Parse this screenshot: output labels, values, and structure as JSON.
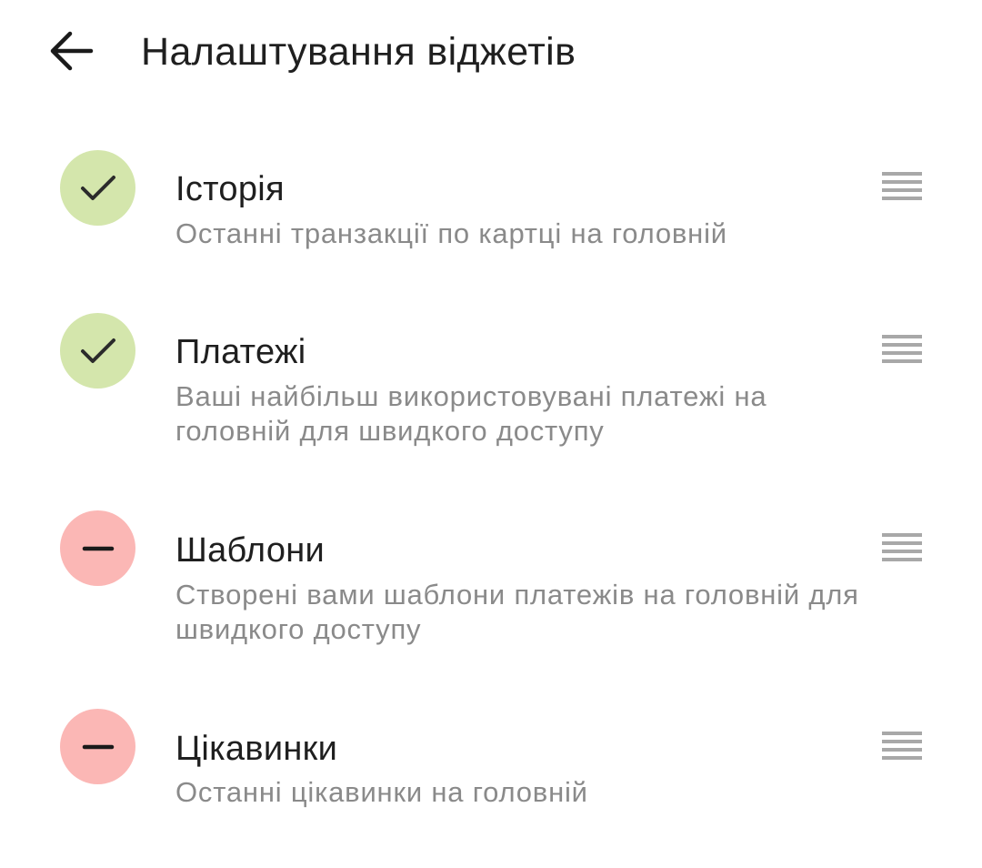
{
  "header": {
    "back_icon": "arrow-left-icon",
    "title": "Налаштування віджетів"
  },
  "colors": {
    "enabled_badge": "#d4e6ac",
    "disabled_badge": "#fbb7b5",
    "title_text": "#1f1f1f",
    "description_text": "#8a8a8a",
    "drag_handle": "#a8a8a8"
  },
  "widgets": [
    {
      "title": "Історія",
      "description": "Останні транзакції по картці на головній",
      "enabled": true,
      "status_icon": "check-icon",
      "handle_icon": "drag-handle-icon"
    },
    {
      "title": "Платежі",
      "description": "Ваші найбільш використовувані платежі на головній для швидкого доступу",
      "enabled": true,
      "status_icon": "check-icon",
      "handle_icon": "drag-handle-icon"
    },
    {
      "title": "Шаблони",
      "description": "Створені вами шаблони платежів на головній для швидкого доступу",
      "enabled": false,
      "status_icon": "minus-icon",
      "handle_icon": "drag-handle-icon"
    },
    {
      "title": "Цікавинки",
      "description": "Останні цікавинки на головній",
      "enabled": false,
      "status_icon": "minus-icon",
      "handle_icon": "drag-handle-icon"
    }
  ]
}
